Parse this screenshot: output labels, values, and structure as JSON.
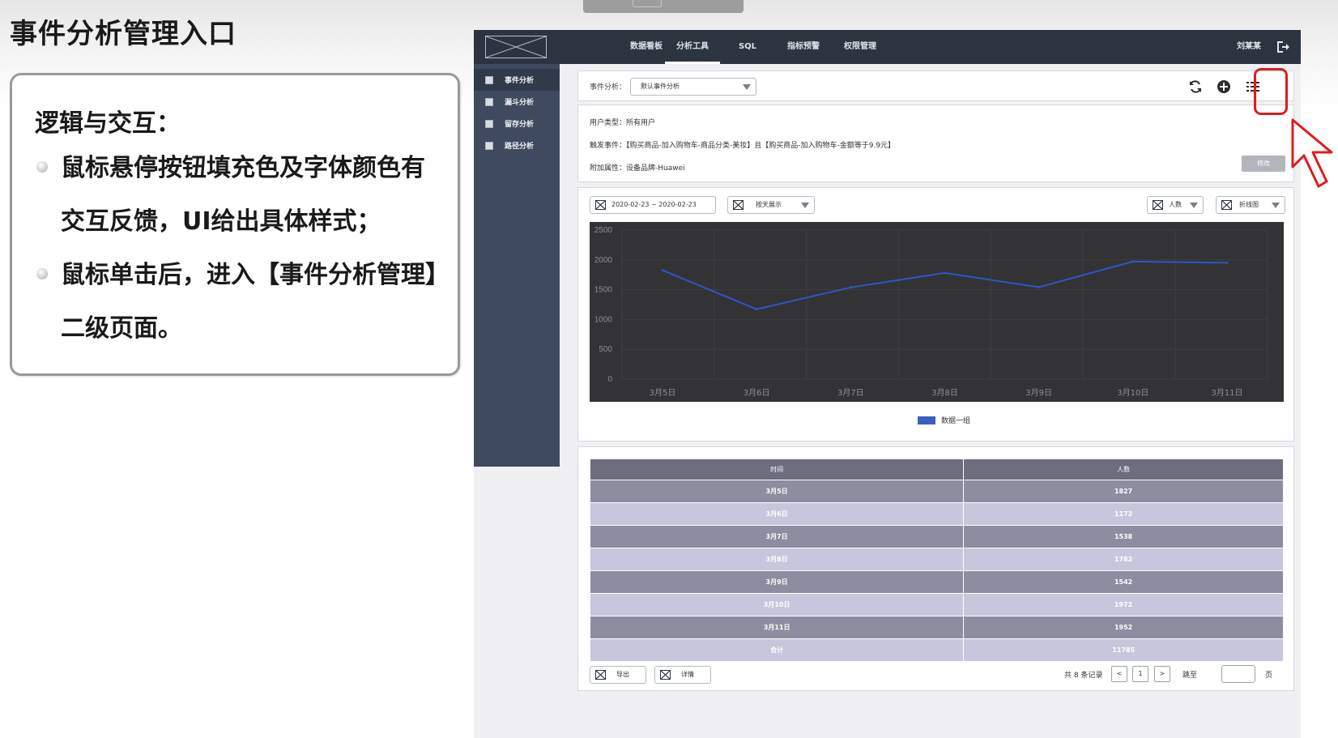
{
  "slide": {
    "title": "事件分析管理入口",
    "heading": "逻辑与交互：",
    "bullets": [
      "鼠标悬停按钮填充色及字体颜色有交互反馈，UI给出具体样式；",
      "鼠标单击后，进入【事件分析管理】二级页面。"
    ]
  },
  "nav": {
    "items": [
      "数据看板",
      "分析工具",
      "SQL",
      "指标预警",
      "权限管理"
    ],
    "active_index": 1,
    "user": "刘某某"
  },
  "sidebar": {
    "items": [
      "事件分析",
      "漏斗分析",
      "留存分析",
      "路径分析"
    ],
    "active_index": 0
  },
  "query": {
    "label": "事件分析：",
    "selected": "默认事件分析",
    "icons": [
      "refresh-icon",
      "add-circle-icon",
      "list-icon"
    ]
  },
  "info": {
    "user_type": "用户类型：所有用户",
    "trigger": "触发事件：【购买商品-加入购物车-商品分类-美妆】且【购买商品-加入购物车-金额等于9.9元】",
    "attribute": "附加属性：设备品牌-Huawei",
    "edit_label": "修改"
  },
  "filters": {
    "date_range": "2020-02-23 ~ 2020-02-23",
    "granularity": "按天展示",
    "metric": "人数",
    "chart_type": "折线图"
  },
  "chart_data": {
    "type": "line",
    "categories": [
      "3月5日",
      "3月6日",
      "3月7日",
      "3月8日",
      "3月9日",
      "3月10日",
      "3月11日"
    ],
    "series": [
      {
        "name": "数据一组",
        "values": [
          1827,
          1172,
          1538,
          1782,
          1542,
          1972,
          1952
        ],
        "color": "#2f55c8"
      }
    ],
    "yticks": [
      0,
      500,
      1000,
      1500,
      2000,
      2500
    ],
    "ylim": [
      0,
      2500
    ],
    "grid": true,
    "background": "#333336",
    "legend": "bottom-center"
  },
  "table": {
    "headers": [
      "时间",
      "人数"
    ],
    "rows": [
      [
        "3月5日",
        "1827"
      ],
      [
        "3月6日",
        "1172"
      ],
      [
        "3月7日",
        "1538"
      ],
      [
        "3月8日",
        "1782"
      ],
      [
        "3月9日",
        "1542"
      ],
      [
        "3月10日",
        "1972"
      ],
      [
        "3月11日",
        "1952"
      ],
      [
        "合计",
        "11785"
      ]
    ],
    "export_label": "导出",
    "detail_label": "详情",
    "total_text": "共 8 条记录",
    "prev": "<",
    "page": "1",
    "next": ">",
    "jump_label": "跳至",
    "page_unit": "页"
  },
  "colors": {
    "topbar": "#2c3440",
    "sidebar": "#3f4a5e",
    "highlight": "#e01b1b",
    "line": "#2f55c8"
  }
}
